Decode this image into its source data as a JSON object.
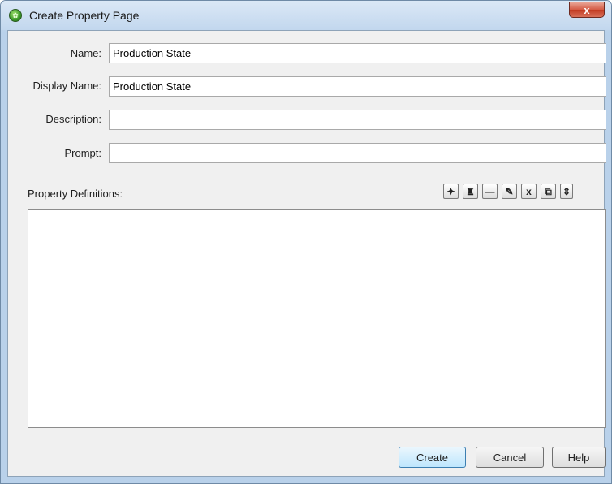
{
  "window": {
    "title": "Create Property Page",
    "close_glyph": "x",
    "app_icon": "app-logo-icon"
  },
  "form": {
    "name": {
      "label": "Name:",
      "value": "Production State"
    },
    "display_name": {
      "label": "Display Name:",
      "value": "Production State"
    },
    "description": {
      "label": "Description:",
      "value": ""
    },
    "prompt": {
      "label": "Prompt:",
      "value": ""
    }
  },
  "property_definitions": {
    "label": "Property Definitions:",
    "toolbar": [
      {
        "name": "new-definition-icon",
        "glyph": "✦"
      },
      {
        "name": "find-icon",
        "glyph": "♜"
      },
      {
        "name": "remove-row-icon",
        "glyph": "—"
      },
      {
        "name": "edit-icon",
        "glyph": "✎"
      },
      {
        "name": "delete-icon",
        "glyph": "x"
      },
      {
        "name": "copy-icon",
        "glyph": "⧉"
      },
      {
        "name": "reorder-icon",
        "glyph": "⇕"
      }
    ],
    "rows": []
  },
  "buttons": {
    "create": "Create",
    "cancel": "Cancel",
    "help": "Help"
  }
}
